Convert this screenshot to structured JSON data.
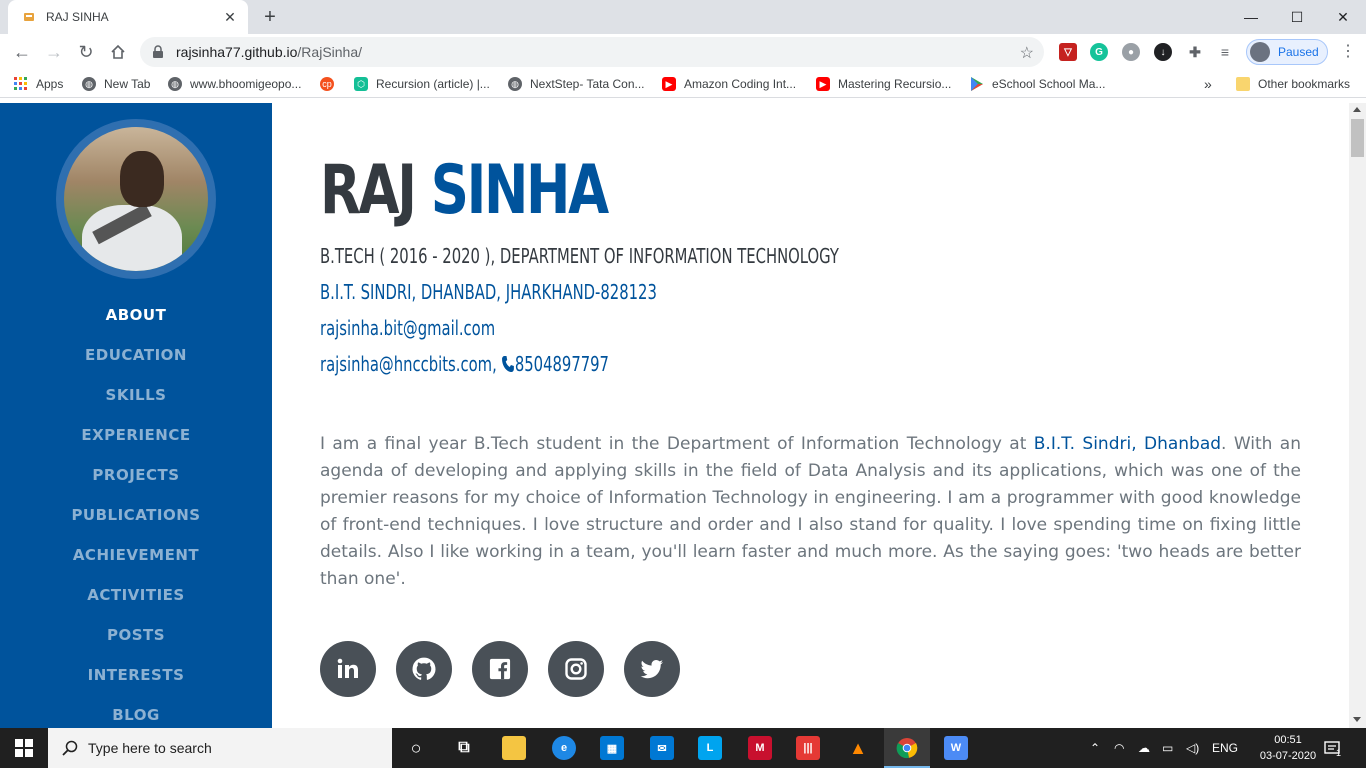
{
  "browser": {
    "tab_title": "RAJ SINHA",
    "tab_close": "✕",
    "new_tab": "+",
    "url_host": "rajsinha77.github.io",
    "url_path": "/RajSinha/",
    "profile_status": "Paused"
  },
  "bookmarks": [
    {
      "label": "Apps",
      "icon": "apps-grid-icon"
    },
    {
      "label": "New Tab",
      "icon": "globe-icon"
    },
    {
      "label": "www.bhoomigeopo...",
      "icon": "globe-icon"
    },
    {
      "label": "",
      "icon": "cp-icon"
    },
    {
      "label": "Recursion (article) |...",
      "icon": "khan-icon"
    },
    {
      "label": "NextStep- Tata Con...",
      "icon": "globe-icon"
    },
    {
      "label": "Amazon Coding Int...",
      "icon": "youtube-icon"
    },
    {
      "label": "Mastering Recursio...",
      "icon": "youtube-icon"
    },
    {
      "label": "eSchool School Ma...",
      "icon": "play-store-icon"
    }
  ],
  "bookmarks_overflow": "»",
  "other_bookmarks": "Other bookmarks",
  "sidebar": {
    "nav": [
      {
        "label": "ABOUT",
        "active": true
      },
      {
        "label": "EDUCATION",
        "active": false
      },
      {
        "label": "SKILLS",
        "active": false
      },
      {
        "label": "EXPERIENCE",
        "active": false
      },
      {
        "label": "PROJECTS",
        "active": false
      },
      {
        "label": "PUBLICATIONS",
        "active": false
      },
      {
        "label": "ACHIEVEMENT",
        "active": false
      },
      {
        "label": "ACTIVITIES",
        "active": false
      },
      {
        "label": "POSTS",
        "active": false
      },
      {
        "label": "INTERESTS",
        "active": false
      },
      {
        "label": "BLOG",
        "active": false
      }
    ]
  },
  "header": {
    "first_name": "RAJ",
    "last_name": "SINHA",
    "degree": "B.TECH ( 2016 - 2020 ), DEPARTMENT OF INFORMATION TECHNOLOGY",
    "college": "B.I.T. SINDRI, DHANBAD, JHARKHAND-828123",
    "email1": "rajsinha.bit@gmail.com",
    "email2": "rajsinha@hnccbits.com,",
    "phone": "8504897797"
  },
  "about": {
    "part1": "I am a final year B.Tech student in the Department of Information Technology at ",
    "highlight": "B.I.T. Sindri, Dhanbad",
    "part2": ". With an agenda of developing and applying skills in the field of Data Analysis and its applications, which was one of the premier reasons for my choice of Information Technology in engineering. I am a programmer with good knowledge of front-end techniques. I love structure and order and I also stand for quality. I love spending time on fixing little details. Also I like working in a team, you'll learn faster and much more. As the saying goes: 'two heads are better than one'."
  },
  "socials": [
    "linkedin-icon",
    "github-icon",
    "facebook-icon",
    "instagram-icon",
    "twitter-icon"
  ],
  "taskbar": {
    "search_placeholder": "Type here to search",
    "language": "ENG",
    "time": "00:51",
    "date": "03-07-2020",
    "notifications": "1"
  },
  "colors": {
    "sidebar": "#00539c",
    "name_dark": "#343a40",
    "accent": "#00539c",
    "body_text": "#6c757d",
    "social_bg": "#495057"
  }
}
